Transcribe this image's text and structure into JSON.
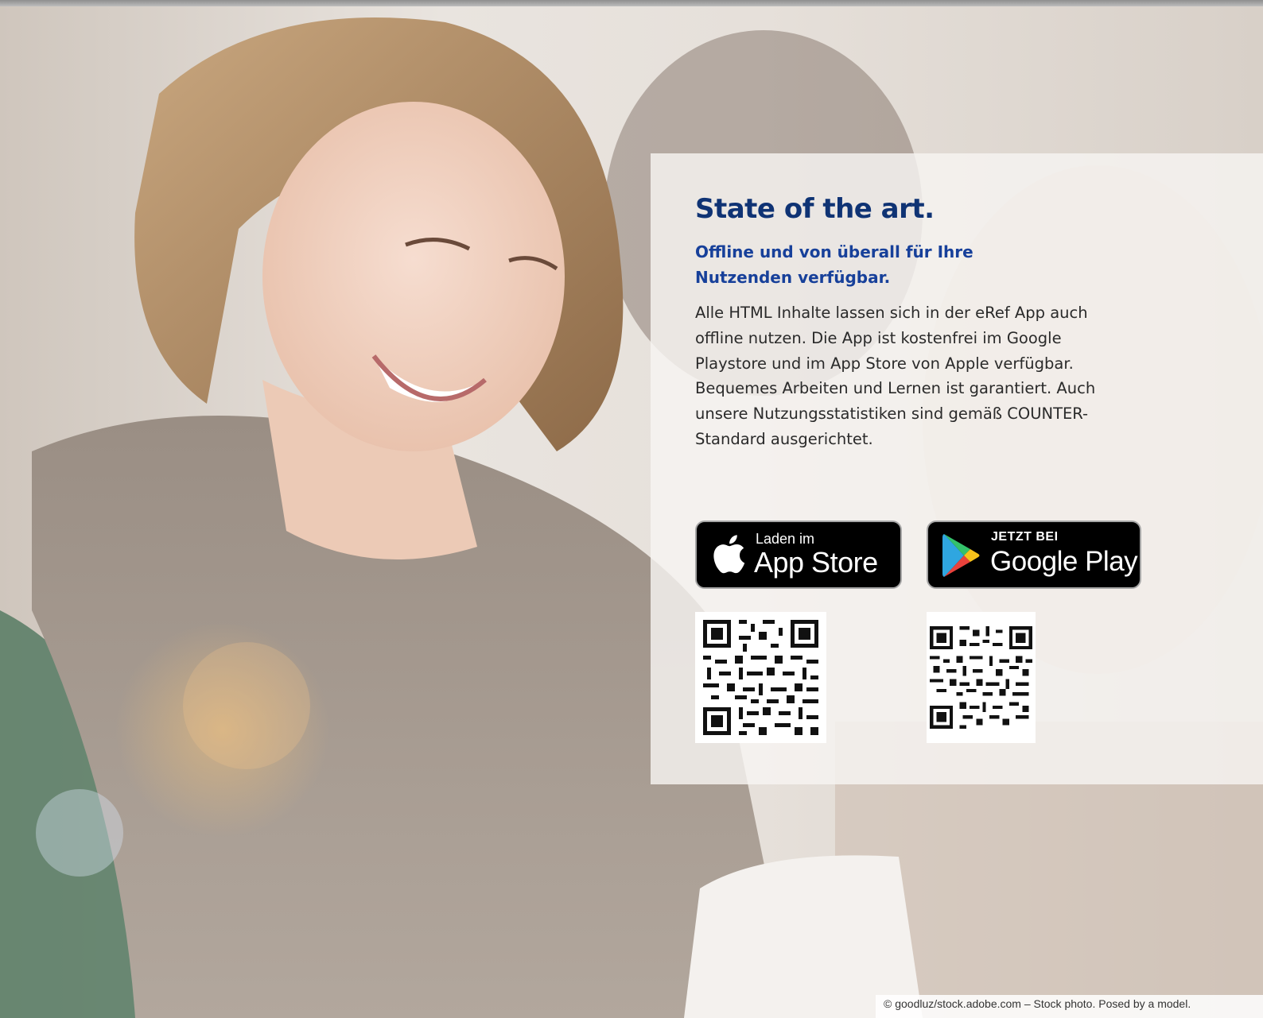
{
  "panel": {
    "title": "State of the art.",
    "subtitle": "Offline und von überall für Ihre Nutzenden verfügbar.",
    "body": "Alle HTML Inhalte lassen sich in der eRef App auch offline nutzen. Die App ist kostenfrei im Google Playstore und im App Store von Apple verfügbar. Bequemes Arbeiten und Lernen ist garantiert. Auch unsere Nutzungsstatistiken sind gemäß COUNTER-Standard ausgerichtet."
  },
  "stores": {
    "appstore": {
      "small_label": "Laden im",
      "big_label": "App Store",
      "icon": "apple-icon"
    },
    "googleplay": {
      "small_label": "JETZT BEI",
      "big_label": "Google Play",
      "icon": "google-play-icon"
    }
  },
  "credit": "© goodluz/stock.adobe.com – Stock photo. Posed by a model.",
  "colors": {
    "title": "#0f3374",
    "subtitle": "#17409a",
    "body_text": "#2a2a2a",
    "panel_bg": "#f7f4f1",
    "badge_bg": "#000000",
    "badge_border": "#a6a6a6"
  }
}
